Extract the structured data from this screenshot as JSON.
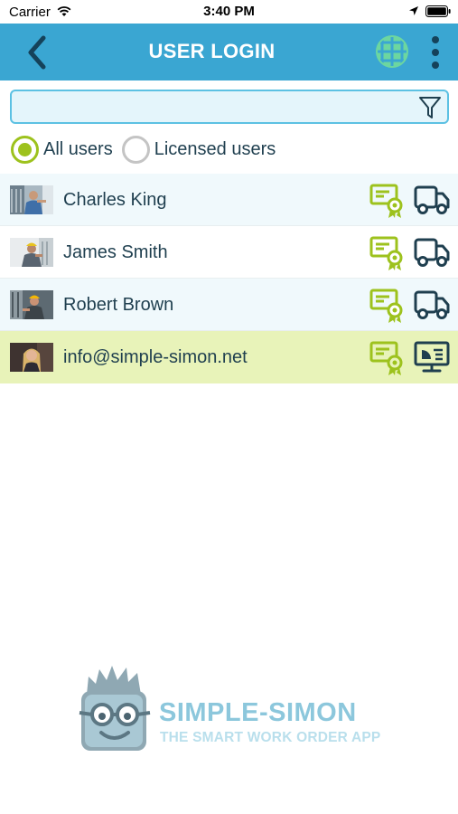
{
  "status_bar": {
    "carrier": "Carrier",
    "time": "3:40 PM",
    "icons": [
      "wifi-icon",
      "location-icon",
      "battery-icon"
    ]
  },
  "nav_bar": {
    "title": "USER LOGIN",
    "back_icon": "chevron-left-icon",
    "language_icon": "globe-icon",
    "menu_icon": "more-vertical-icon",
    "colors": {
      "background": "#3aa6d2",
      "globe": "#6cd6a0"
    }
  },
  "search": {
    "value": "",
    "placeholder": "",
    "filter_icon": "filter-icon"
  },
  "user_filter": {
    "options": [
      {
        "label": "All users",
        "selected": true
      },
      {
        "label": "Licensed users",
        "selected": false
      }
    ],
    "accent_color": "#9dc21d"
  },
  "users": [
    {
      "name": "Charles King",
      "license_icon": "license-certificate-icon",
      "device_icon": "truck-icon"
    },
    {
      "name": "James Smith",
      "license_icon": "license-certificate-icon",
      "device_icon": "truck-icon"
    },
    {
      "name": "Robert Brown",
      "license_icon": "license-certificate-icon",
      "device_icon": "truck-icon"
    },
    {
      "name": "info@simple-simon.net",
      "license_icon": "license-certificate-icon",
      "device_icon": "monitor-icon",
      "highlighted": true
    }
  ],
  "brand": {
    "name": "SIMPLE-SIMON",
    "tagline": "THE SMART WORK ORDER APP"
  }
}
